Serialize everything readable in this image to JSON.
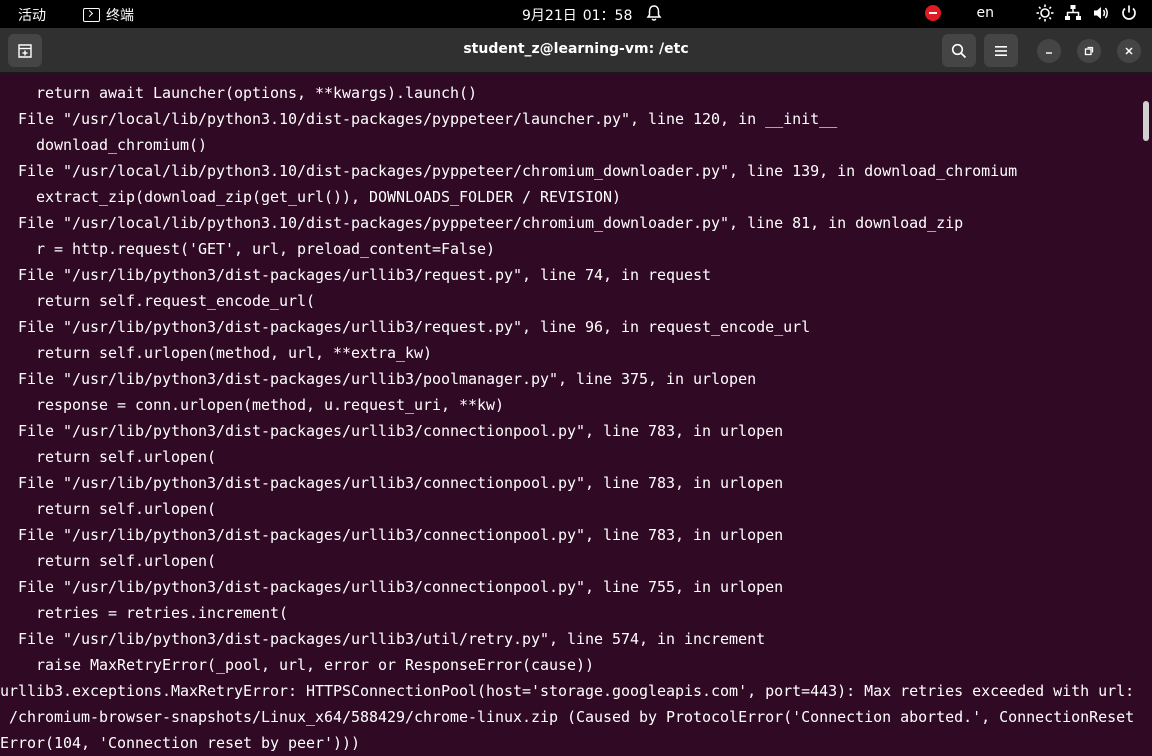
{
  "topbar": {
    "activities": "活动",
    "app_name": "终端",
    "date": "9月21日",
    "time": "01：58",
    "language": "en"
  },
  "window": {
    "title": "student_z@learning-vm: /etc"
  },
  "terminal": {
    "lines": [
      "    return await Launcher(options, **kwargs).launch()",
      "  File \"/usr/local/lib/python3.10/dist-packages/pyppeteer/launcher.py\", line 120, in __init__",
      "    download_chromium()",
      "  File \"/usr/local/lib/python3.10/dist-packages/pyppeteer/chromium_downloader.py\", line 139, in download_chromium",
      "    extract_zip(download_zip(get_url()), DOWNLOADS_FOLDER / REVISION)",
      "  File \"/usr/local/lib/python3.10/dist-packages/pyppeteer/chromium_downloader.py\", line 81, in download_zip",
      "    r = http.request('GET', url, preload_content=False)",
      "  File \"/usr/lib/python3/dist-packages/urllib3/request.py\", line 74, in request",
      "    return self.request_encode_url(",
      "  File \"/usr/lib/python3/dist-packages/urllib3/request.py\", line 96, in request_encode_url",
      "    return self.urlopen(method, url, **extra_kw)",
      "  File \"/usr/lib/python3/dist-packages/urllib3/poolmanager.py\", line 375, in urlopen",
      "    response = conn.urlopen(method, u.request_uri, **kw)",
      "  File \"/usr/lib/python3/dist-packages/urllib3/connectionpool.py\", line 783, in urlopen",
      "    return self.urlopen(",
      "  File \"/usr/lib/python3/dist-packages/urllib3/connectionpool.py\", line 783, in urlopen",
      "    return self.urlopen(",
      "  File \"/usr/lib/python3/dist-packages/urllib3/connectionpool.py\", line 783, in urlopen",
      "    return self.urlopen(",
      "  File \"/usr/lib/python3/dist-packages/urllib3/connectionpool.py\", line 755, in urlopen",
      "    retries = retries.increment(",
      "  File \"/usr/lib/python3/dist-packages/urllib3/util/retry.py\", line 574, in increment",
      "    raise MaxRetryError(_pool, url, error or ResponseError(cause))",
      "urllib3.exceptions.MaxRetryError: HTTPSConnectionPool(host='storage.googleapis.com', port=443): Max retries exceeded with url:",
      " /chromium-browser-snapshots/Linux_x64/588429/chrome-linux.zip (Caused by ProtocolError('Connection aborted.', ConnectionReset",
      "Error(104, 'Connection reset by peer')))"
    ]
  },
  "icons": {
    "activities": "activities-label",
    "app": "terminal-icon",
    "bell": "bell-icon",
    "dnd": "do-not-disturb-icon",
    "brightness": "brightness-icon",
    "network": "network-icon",
    "volume": "volume-icon",
    "power": "power-icon",
    "new_tab": "new-tab-icon",
    "search": "search-icon",
    "menu": "hamburger-menu-icon",
    "minimize": "minimize-icon",
    "maximize": "maximize-icon",
    "close": "close-icon"
  },
  "colors": {
    "terminal_bg": "#300a24",
    "header_bg": "#303030",
    "dnd_red": "#e01b24"
  }
}
